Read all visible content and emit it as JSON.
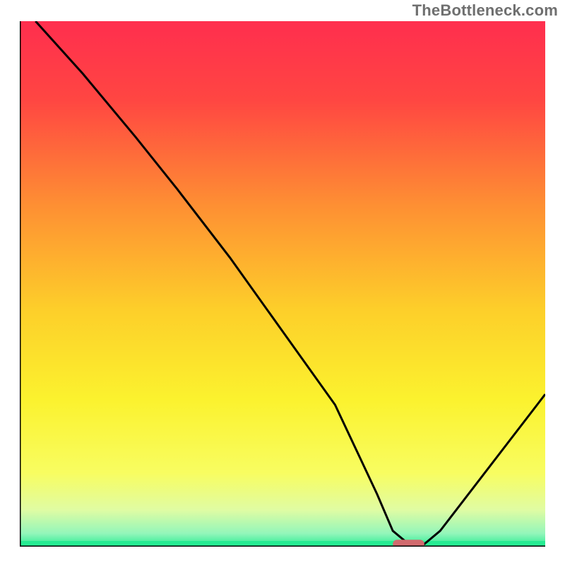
{
  "watermark": "TheBottleneck.com",
  "colors": {
    "gradient_stops": [
      {
        "offset": 0.0,
        "color": "#ff2e4e"
      },
      {
        "offset": 0.15,
        "color": "#ff4642"
      },
      {
        "offset": 0.35,
        "color": "#fe8f33"
      },
      {
        "offset": 0.55,
        "color": "#fdcf2a"
      },
      {
        "offset": 0.72,
        "color": "#fbf22e"
      },
      {
        "offset": 0.86,
        "color": "#f8fd61"
      },
      {
        "offset": 0.93,
        "color": "#e0fca3"
      },
      {
        "offset": 0.975,
        "color": "#93f6ba"
      },
      {
        "offset": 1.0,
        "color": "#26eb92"
      }
    ],
    "curve": "#000000",
    "marker_fill": "#d16a6e",
    "axis": "#000000"
  },
  "chart_data": {
    "type": "line",
    "title": "",
    "xlabel": "",
    "ylabel": "",
    "xlim": [
      0,
      100
    ],
    "ylim": [
      0,
      100
    ],
    "x": [
      3,
      12,
      22,
      30,
      40,
      50,
      60,
      68,
      71,
      74,
      77,
      80,
      100
    ],
    "values": [
      100,
      90,
      78,
      68,
      55,
      41,
      27,
      10,
      3,
      0.5,
      0.5,
      3,
      29
    ],
    "marker": {
      "x_start": 71,
      "x_end": 77,
      "y": 0.5
    },
    "annotations": []
  }
}
